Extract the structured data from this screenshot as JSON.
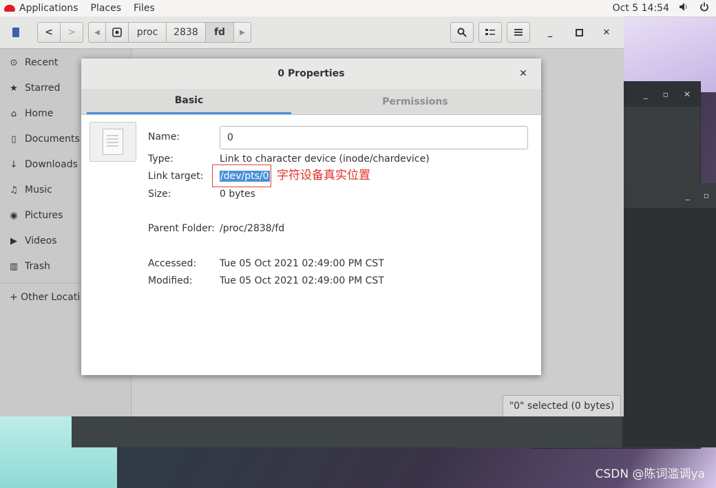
{
  "topbar": {
    "applications": "Applications",
    "places": "Places",
    "files": "Files",
    "datetime": "Oct 5  14:54",
    "volume_icon": "volume-icon",
    "power_icon": "power-icon"
  },
  "file_manager": {
    "path": [
      "proc",
      "2838",
      "fd"
    ],
    "sidebar": [
      {
        "icon": "clock-icon",
        "glyph": "⊙",
        "label": "Recent"
      },
      {
        "icon": "star-icon",
        "glyph": "★",
        "label": "Starred"
      },
      {
        "icon": "home-icon",
        "glyph": "⌂",
        "label": "Home"
      },
      {
        "icon": "document-icon",
        "glyph": "▯",
        "label": "Documents"
      },
      {
        "icon": "download-icon",
        "glyph": "↓",
        "label": "Downloads"
      },
      {
        "icon": "music-icon",
        "glyph": "♫",
        "label": "Music"
      },
      {
        "icon": "camera-icon",
        "glyph": "◉",
        "label": "Pictures"
      },
      {
        "icon": "video-icon",
        "glyph": "▶",
        "label": "Videos"
      },
      {
        "icon": "trash-icon",
        "glyph": "🗑",
        "label": "Trash"
      }
    ],
    "other_locations": "+ Other Locati",
    "status": "\"0\" selected  (0 bytes)"
  },
  "dialog": {
    "title": "0 Properties",
    "tabs": {
      "basic": "Basic",
      "permissions": "Permissions"
    },
    "fields": {
      "name_label": "Name:",
      "name_value": "0",
      "type_label": "Type:",
      "type_value": "Link to character device (inode/chardevice)",
      "link_label": "Link target:",
      "link_value": "/dev/pts/0",
      "size_label": "Size:",
      "size_value": "0 bytes",
      "parent_label": "Parent Folder:",
      "parent_value": "/proc/2838/fd",
      "accessed_label": "Accessed:",
      "accessed_value": "Tue 05 Oct 2021 02:49:00 PM CST",
      "modified_label": "Modified:",
      "modified_value": "Tue 05 Oct 2021 02:49:00 PM CST"
    },
    "annotation": "字符设备真实位置"
  },
  "watermark": "CSDN @陈词滥调ya",
  "colors": {
    "selection": "#4a90d9",
    "annotation": "#e0312a",
    "redhat": "#e01b24"
  }
}
